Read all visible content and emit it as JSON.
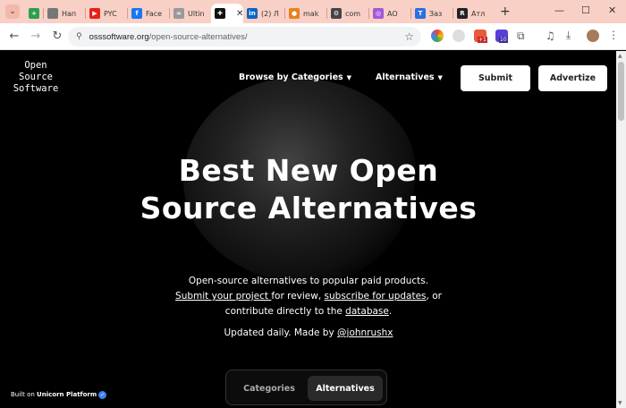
{
  "browser": {
    "tabs": [
      {
        "label": "",
        "favicon_color": "#2e9e4f",
        "favicon_glyph": "+"
      },
      {
        "label": "Нап",
        "favicon_color": "#777777",
        "favicon_glyph": ""
      },
      {
        "label": "PYC",
        "favicon_color": "#e62117",
        "favicon_glyph": "▶"
      },
      {
        "label": "Face",
        "favicon_color": "#1877f2",
        "favicon_glyph": "f"
      },
      {
        "label": "Ultin",
        "favicon_color": "#999999",
        "favicon_glyph": "∞"
      },
      {
        "label": "",
        "favicon_color": "#111111",
        "favicon_glyph": "✚",
        "active": true
      },
      {
        "label": "(2) Л",
        "favicon_color": "#0a66c2",
        "favicon_glyph": "in"
      },
      {
        "label": "mak",
        "favicon_color": "#e8821e",
        "favicon_glyph": "●"
      },
      {
        "label": "com",
        "favicon_color": "#444444",
        "favicon_glyph": "⚙"
      },
      {
        "label": "AO",
        "favicon_color": "#a259d9",
        "favicon_glyph": "◎"
      },
      {
        "label": "Заз",
        "favicon_color": "#2d6fe0",
        "favicon_glyph": "T"
      },
      {
        "label": "Атл",
        "favicon_color": "#222222",
        "favicon_glyph": "R"
      }
    ],
    "new_tab": "+",
    "window_controls": {
      "minimize": "—",
      "maximize": "☐",
      "close": "✕"
    },
    "url_host": "osssoftware.org",
    "url_path": "/open-source-alternatives/",
    "extension_badges": [
      "+1",
      "10"
    ]
  },
  "page": {
    "logo_lines": [
      "Open",
      "Source",
      "Software"
    ],
    "nav": {
      "browse": "Browse by Categories",
      "alternatives": "Alternatives",
      "submit": "Submit",
      "advertize": "Advertize"
    },
    "hero": {
      "title": "Best New Open Source Alternatives",
      "sub_line1": "Open-source alternatives to popular paid products.",
      "link_submit": "Submit your project ",
      "text_review": "for review, ",
      "link_subscribe": "subscribe for updates",
      "text_or": ", or",
      "text_contribute": "contribute directly to the ",
      "link_database": "database",
      "text_period": ".",
      "updated_prefix": "Updated daily. Made by ",
      "updated_handle": "@johnrushx"
    },
    "toggle": {
      "categories": "Categories",
      "alternatives": "Alternatives",
      "selected": "Alternatives"
    },
    "built_prefix": "Built on ",
    "built_platform": "Unicorn Platform"
  },
  "colors": {
    "tab_strip": "#f8d0c6",
    "page_bg": "#000000",
    "button_bg": "#ffffff",
    "toggle_selected": "#2a2a2a"
  }
}
